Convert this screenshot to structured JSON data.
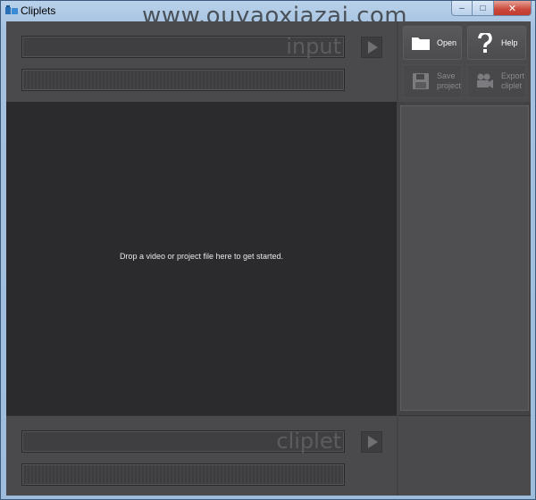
{
  "window": {
    "title": "Cliplets",
    "watermark": "www.ouyaoxiazai.com",
    "controls": {
      "minimize": "–",
      "maximize": "□",
      "close": "✕"
    }
  },
  "input_panel": {
    "label": "input",
    "play_icon": "play-icon"
  },
  "output_panel": {
    "label": "cliplet",
    "play_icon": "play-icon"
  },
  "stage": {
    "message": "Drop a video or project file here to get started."
  },
  "toolbar": {
    "open_label": "Open",
    "help_label": "Help",
    "save_label_1": "Save",
    "save_label_2": "project",
    "export_label_1": "Export",
    "export_label_2": "cliplet",
    "icons": [
      "folder-icon",
      "question-icon",
      "floppy-disk-icon",
      "film-camera-icon"
    ]
  },
  "colors": {
    "background": "#2b2b2d",
    "panel": "#4a4a4d",
    "text": "#e8e8e8"
  }
}
